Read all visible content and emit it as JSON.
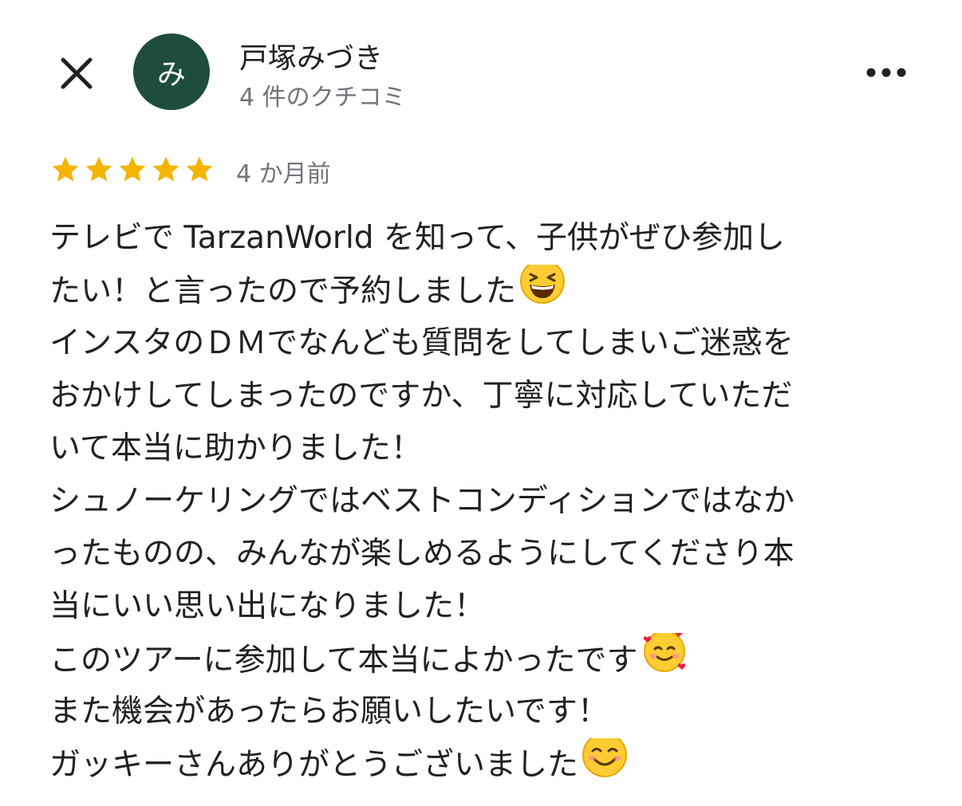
{
  "reviewer": {
    "avatar_initial": "み",
    "name": "戸塚みづき",
    "review_count": "4 件のクチコミ"
  },
  "review": {
    "rating": 5,
    "time_ago": "4 か月前",
    "lines": [
      "テレビで TarzanWorld を知って、子供がぜひ参加し",
      "たい！と言ったので予約しました",
      "インスタのＤＭでなんども質問をしてしまいご迷惑を",
      "おかけしてしまったのですか、丁寧に対応していただ",
      "いて本当に助かりました！",
      "シュノーケリングではベストコンディションではなか",
      "ったものの、みんなが楽しめるようにしてくださり本",
      "当にいい思い出になりました！",
      "このツアーに参加して本当によかったです",
      "また機会があったらお願いしたいです！",
      "ガッキーさんありがとうございました"
    ]
  },
  "icons": {
    "close": "close-icon",
    "more": "more-horizontal-icon",
    "star": "star-icon",
    "emoji_laughing": "grinning-squinting-face-emoji",
    "emoji_hearts": "smiling-face-with-hearts-emoji",
    "emoji_smile": "smiling-face-emoji"
  },
  "colors": {
    "avatar_bg": "#1f4d3d",
    "star": "#f4b400",
    "text": "#202124",
    "secondary_text": "#70757a"
  }
}
